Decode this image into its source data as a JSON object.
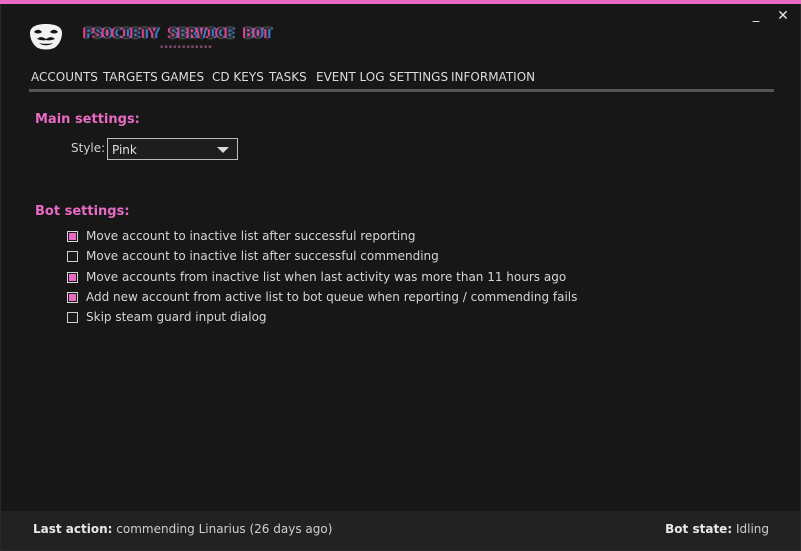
{
  "window": {
    "minimize_glyph": "_",
    "close_glyph": "✕",
    "accent_color": "#e86ac4"
  },
  "brand": {
    "title": "FSOCIETY SERVICE BOT",
    "logo_icon": "mask-icon"
  },
  "tabs": [
    {
      "label": "ACCOUNTS",
      "active": false
    },
    {
      "label": "TARGETS",
      "active": false
    },
    {
      "label": "GAMES",
      "active": false
    },
    {
      "label": "CD KEYS",
      "active": false
    },
    {
      "label": "TASKS",
      "active": false
    },
    {
      "label": "EVENT LOG",
      "active": false
    },
    {
      "label": "SETTINGS",
      "active": true
    },
    {
      "label": "INFORMATION",
      "active": false
    }
  ],
  "main_settings": {
    "title": "Main settings:",
    "style_label": "Style:",
    "style_value": "Pink"
  },
  "bot_settings": {
    "title": "Bot settings:",
    "options": [
      {
        "label": "Move account to inactive list after successful reporting",
        "checked": true
      },
      {
        "label": "Move account to inactive list after successful commending",
        "checked": false
      },
      {
        "label": "Move accounts from inactive list when last activity was more than 11 hours ago",
        "checked": true
      },
      {
        "label": "Add new account from active list to bot queue when reporting / commending fails",
        "checked": true
      },
      {
        "label": "Skip steam guard input dialog",
        "checked": false
      }
    ]
  },
  "status": {
    "last_action_label": "Last action:",
    "last_action_value": "commending Linarius (26 days ago)",
    "bot_state_label": "Bot state:",
    "bot_state_value": "Idling"
  }
}
